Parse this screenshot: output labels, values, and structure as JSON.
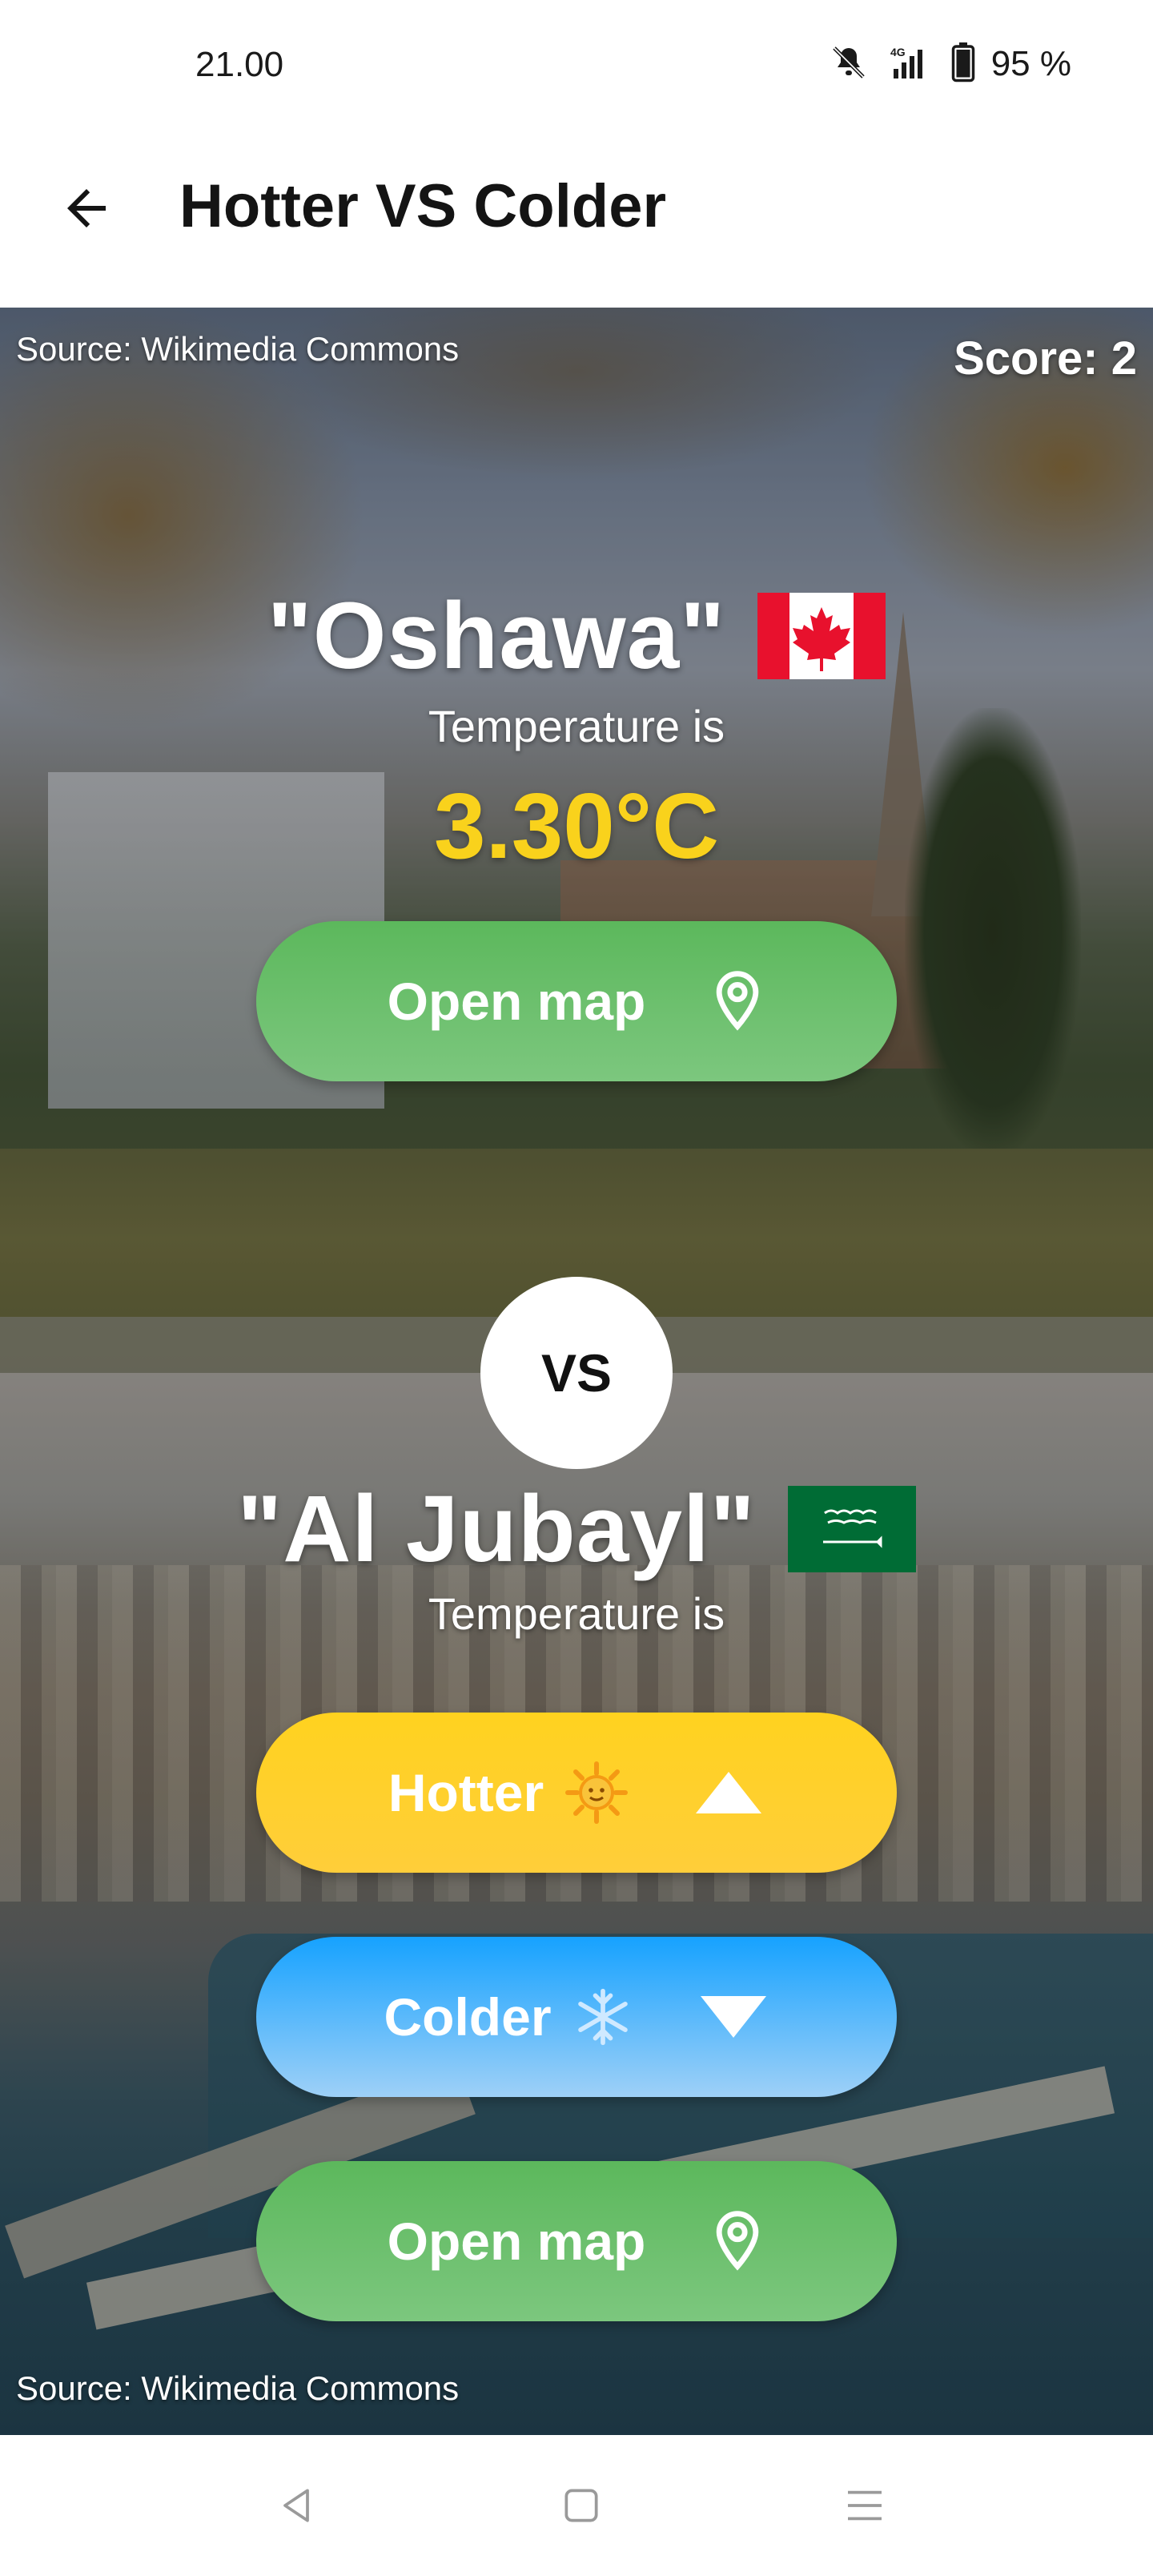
{
  "status_bar": {
    "time": "21.00",
    "network": "4G",
    "battery": "95 %"
  },
  "app_bar": {
    "title": "Hotter VS Colder"
  },
  "score": "Score: 2",
  "top_city": {
    "source": "Source: Wikimedia Commons",
    "name": "\"Oshawa\"",
    "flag": "canada-flag",
    "temperature_label": "Temperature is",
    "temperature_value": "3.30°C",
    "open_map_label": "Open map"
  },
  "vs_label": "VS",
  "bottom_city": {
    "source": "Source: Wikimedia Commons",
    "name": "\"Al Jubayl\"",
    "flag": "saudi-arabia-flag",
    "temperature_label": "Temperature is",
    "hotter_label": "Hotter",
    "colder_label": "Colder",
    "open_map_label": "Open map"
  },
  "colors": {
    "green": "#5cb85c",
    "yellow": "#ffd21f",
    "blue": "#16a2ff",
    "temp_yellow": "#f9d21c"
  },
  "icons": {
    "back": "arrow-left-icon",
    "map_pin": "map-pin-icon",
    "sun": "sun-icon",
    "snowflake": "snowflake-icon",
    "up": "triangle-up-icon",
    "down": "triangle-down-icon"
  }
}
